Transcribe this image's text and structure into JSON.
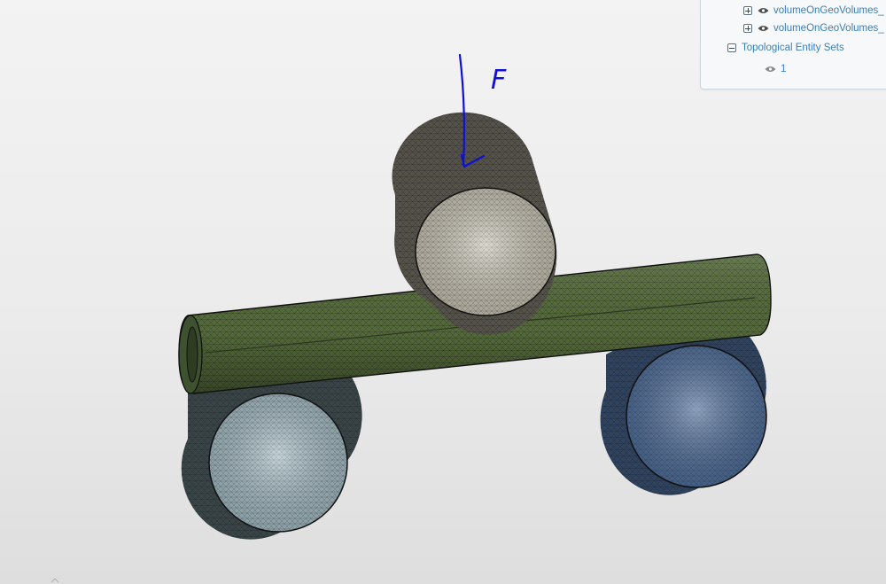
{
  "tree": {
    "items": [
      {
        "label": "volumeOnGeoVolumes_",
        "expanded": false,
        "visible": true,
        "icon": "eye-icon"
      },
      {
        "label": "volumeOnGeoVolumes_",
        "expanded": false,
        "visible": true,
        "icon": "eye-icon"
      }
    ],
    "section": {
      "label": "Topological Entity Sets",
      "expanded": true
    },
    "children": [
      {
        "label": "1",
        "visible": true,
        "icon": "eye-icon"
      }
    ]
  },
  "viewport": {
    "annotation": {
      "label": "F",
      "color": "#1010d0"
    },
    "parts": [
      {
        "name": "beam",
        "color": "#556b3b"
      },
      {
        "name": "loading-roller",
        "color": "#c9c5b5"
      },
      {
        "name": "left-support",
        "color": "#a4bcc4"
      },
      {
        "name": "right-support",
        "color": "#4f6f9c"
      }
    ]
  }
}
